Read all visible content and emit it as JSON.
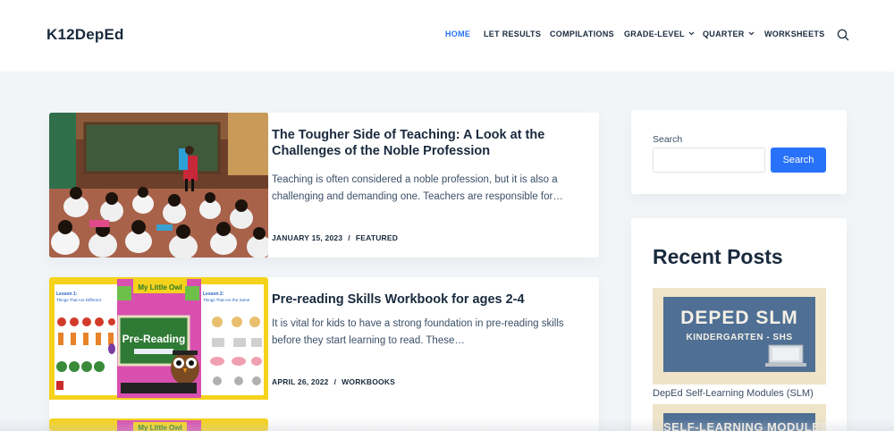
{
  "site": {
    "logo": "K12DepEd"
  },
  "nav": {
    "items": [
      {
        "label": "HOME",
        "active": true,
        "dropdown": false
      },
      {
        "label": "LET RESULTS",
        "active": false,
        "dropdown": false
      },
      {
        "label": "COMPILATIONS",
        "active": false,
        "dropdown": false
      },
      {
        "label": "GRADE-LEVEL",
        "active": false,
        "dropdown": true
      },
      {
        "label": "QUARTER",
        "active": false,
        "dropdown": true
      },
      {
        "label": "WORKSHEETS",
        "active": false,
        "dropdown": false
      }
    ],
    "search_icon": "search-icon"
  },
  "posts": [
    {
      "title": "The Tougher Side of Teaching: A Look at the Challenges of the Noble Profession",
      "excerpt": "Teaching is often considered a noble profession, but it is also a challenging and demanding one. Teachers are responsible for…",
      "date": "JANUARY 15, 2023",
      "category": "FEATURED",
      "separator": "/"
    },
    {
      "title": "Pre-reading Skills Workbook for ages 2-4",
      "excerpt": "It is vital for kids to have a strong foundation in pre-reading skills before they start learning to read. These…",
      "date": "APRIL 26, 2022",
      "category": "WORKBOOKS",
      "separator": "/",
      "thumb_text": {
        "board": "Pre-Reading",
        "banner": "My Little Owl",
        "lesson_left": "Lesson 1:",
        "lesson_left_sub": "Things That Are Different",
        "lesson_right": "Lesson 2:",
        "lesson_right_sub": "Things That Are the Same"
      }
    },
    {
      "thumb_text": {
        "banner": "My Little Owl"
      }
    }
  ],
  "sidebar": {
    "search": {
      "label": "Search",
      "button": "Search",
      "value": ""
    },
    "recent": {
      "title": "Recent Posts",
      "items": [
        {
          "label": "DepEd Self-Learning Modules (SLM)",
          "thumb_line1": "DEPED SLM",
          "thumb_line2": "KINDERGARTEN - SHS"
        },
        {
          "thumb_line1": "SELF-LEARNING MODULES"
        }
      ]
    }
  },
  "colors": {
    "accent": "#2872fa",
    "heading": "#192a3d",
    "text": "#3a4f66",
    "background": "#f2f5f8"
  }
}
